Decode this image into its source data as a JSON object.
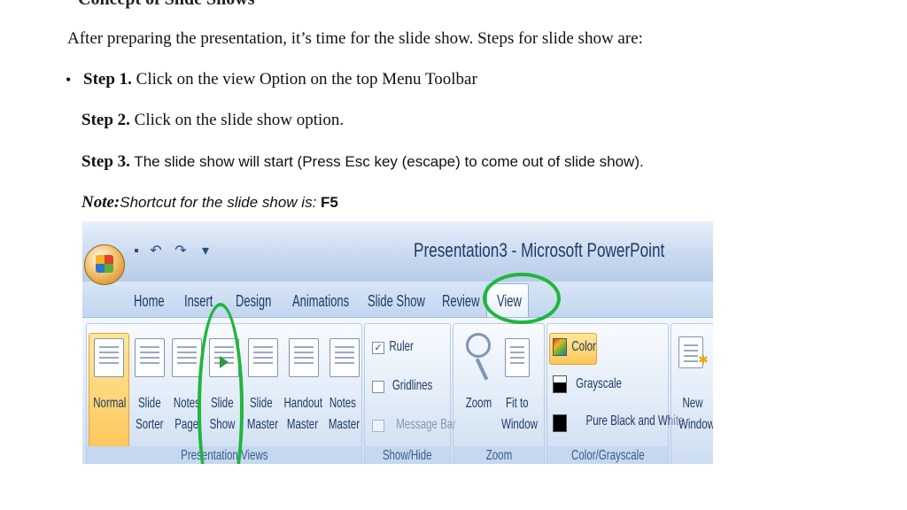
{
  "heading_cut": "Concept of Slide Shows",
  "intro": "After preparing the presentation, it’s time for the slide show. Steps for slide show are:",
  "bullet_glyph": "•",
  "steps": [
    {
      "label": "Step 1.",
      "text": " Click on the view Option on the top Menu Toolbar"
    },
    {
      "label": "Step 2.",
      "text": " Click on the slide show option."
    },
    {
      "label": "Step 3.",
      "text": " The slide show will start (Press Esc key (escape) to come out of slide show)."
    }
  ],
  "note": {
    "label": "Note:",
    "text": "Shortcut for the slide show is: ",
    "key": "F5"
  },
  "screenshot": {
    "app_title": "Presentation3 - Microsoft PowerPoint",
    "qa_icons": [
      "save-icon",
      "undo-icon",
      "redo-icon",
      "customize-icon"
    ],
    "qa_glyphs": [
      "▪",
      "↶",
      "↷",
      "▾"
    ],
    "tabs": [
      "Home",
      "Insert",
      "Design",
      "Animations",
      "Slide Show",
      "Review",
      "View"
    ],
    "active_tab": "View",
    "groups": {
      "presentation_views": "Presentation Views",
      "show_hide": "Show/Hide",
      "zoom": "Zoom",
      "color_grayscale": "Color/Grayscale"
    },
    "buttons": {
      "normal": "Normal",
      "slide_sorter": [
        "Slide",
        "Sorter"
      ],
      "notes_page": [
        "Notes",
        "Page"
      ],
      "slide_show": [
        "Slide",
        "Show"
      ],
      "slide_master": [
        "Slide",
        "Master"
      ],
      "handout_master": [
        "Handout",
        "Master"
      ],
      "notes_master": [
        "Notes",
        "Master"
      ],
      "ruler": "Ruler",
      "gridlines": "Gridlines",
      "message_bar": "Message Bar",
      "zoom": "Zoom",
      "fit_to_window": [
        "Fit to",
        "Window"
      ],
      "color": "Color",
      "grayscale": "Grayscale",
      "pure_black_white": "Pure Black and White",
      "new_window": [
        "New",
        "Window"
      ]
    },
    "colors": {
      "highlight_circle": "#1fb63c",
      "ribbon_blue": "#c9dcf2",
      "active_button": "#ffc65a"
    }
  }
}
